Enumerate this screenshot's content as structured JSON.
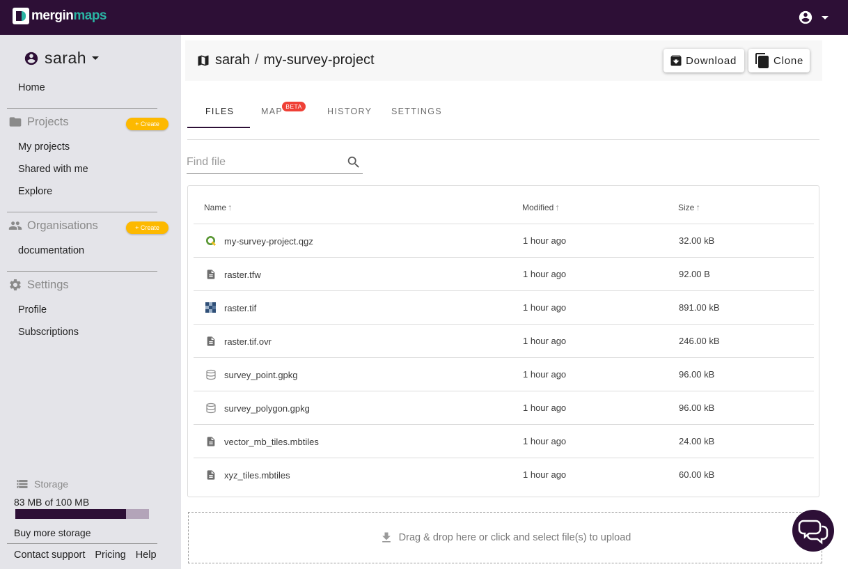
{
  "app": {
    "logo_text": "mergin",
    "logo_accent": "maps",
    "brand_color": "#2d0f36",
    "accent_color": "#2ab3a3"
  },
  "topbar": {
    "account_icon": "account-circle-icon",
    "menu_icon": "caret-down-icon"
  },
  "sidebar": {
    "username": "sarah",
    "home": "Home",
    "projects_head": "Projects",
    "projects_create": "+ Create",
    "my_projects": "My projects",
    "shared_with_me": "Shared with me",
    "explore": "Explore",
    "organisations_head": "Organisations",
    "organisations_create": "+ Create",
    "organisation_name": "documentation",
    "settings_head": "Settings",
    "profile": "Profile",
    "subscriptions": "Subscriptions",
    "storage_head": "Storage",
    "storage_text": "83 MB of 100 MB",
    "storage_used_fraction": 0.83,
    "buy_more": "Buy more storage",
    "contact_support": "Contact support",
    "pricing": "Pricing",
    "help": "Help"
  },
  "header": {
    "owner": "sarah",
    "separator": "/",
    "project_name": "my-survey-project",
    "download_label": "Download",
    "clone_label": "Clone"
  },
  "tabs": {
    "files": "FILES",
    "map": "MAP",
    "beta": "BETA",
    "history": "HISTORY",
    "settings": "SETTINGS",
    "active": "files"
  },
  "search": {
    "placeholder": "Find file",
    "value": ""
  },
  "table": {
    "columns": {
      "name": "Name",
      "modified": "Modified",
      "size": "Size"
    },
    "rows": [
      {
        "name": "my-survey-project.qgz",
        "modified": "1 hour ago",
        "size": "32.00 kB",
        "icon": "qgis-icon"
      },
      {
        "name": "raster.tfw",
        "modified": "1 hour ago",
        "size": "92.00 B",
        "icon": "file-icon"
      },
      {
        "name": "raster.tif",
        "modified": "1 hour ago",
        "size": "891.00 kB",
        "icon": "raster-icon"
      },
      {
        "name": "raster.tif.ovr",
        "modified": "1 hour ago",
        "size": "246.00 kB",
        "icon": "file-icon"
      },
      {
        "name": "survey_point.gpkg",
        "modified": "1 hour ago",
        "size": "96.00 kB",
        "icon": "database-icon"
      },
      {
        "name": "survey_polygon.gpkg",
        "modified": "1 hour ago",
        "size": "96.00 kB",
        "icon": "database-icon"
      },
      {
        "name": "vector_mb_tiles.mbtiles",
        "modified": "1 hour ago",
        "size": "24.00 kB",
        "icon": "file-icon"
      },
      {
        "name": "xyz_tiles.mbtiles",
        "modified": "1 hour ago",
        "size": "60.00 kB",
        "icon": "file-icon"
      }
    ]
  },
  "upload": {
    "label": "Drag & drop here or click and select file(s) to upload"
  },
  "chat": {
    "icon": "chat-icon"
  }
}
